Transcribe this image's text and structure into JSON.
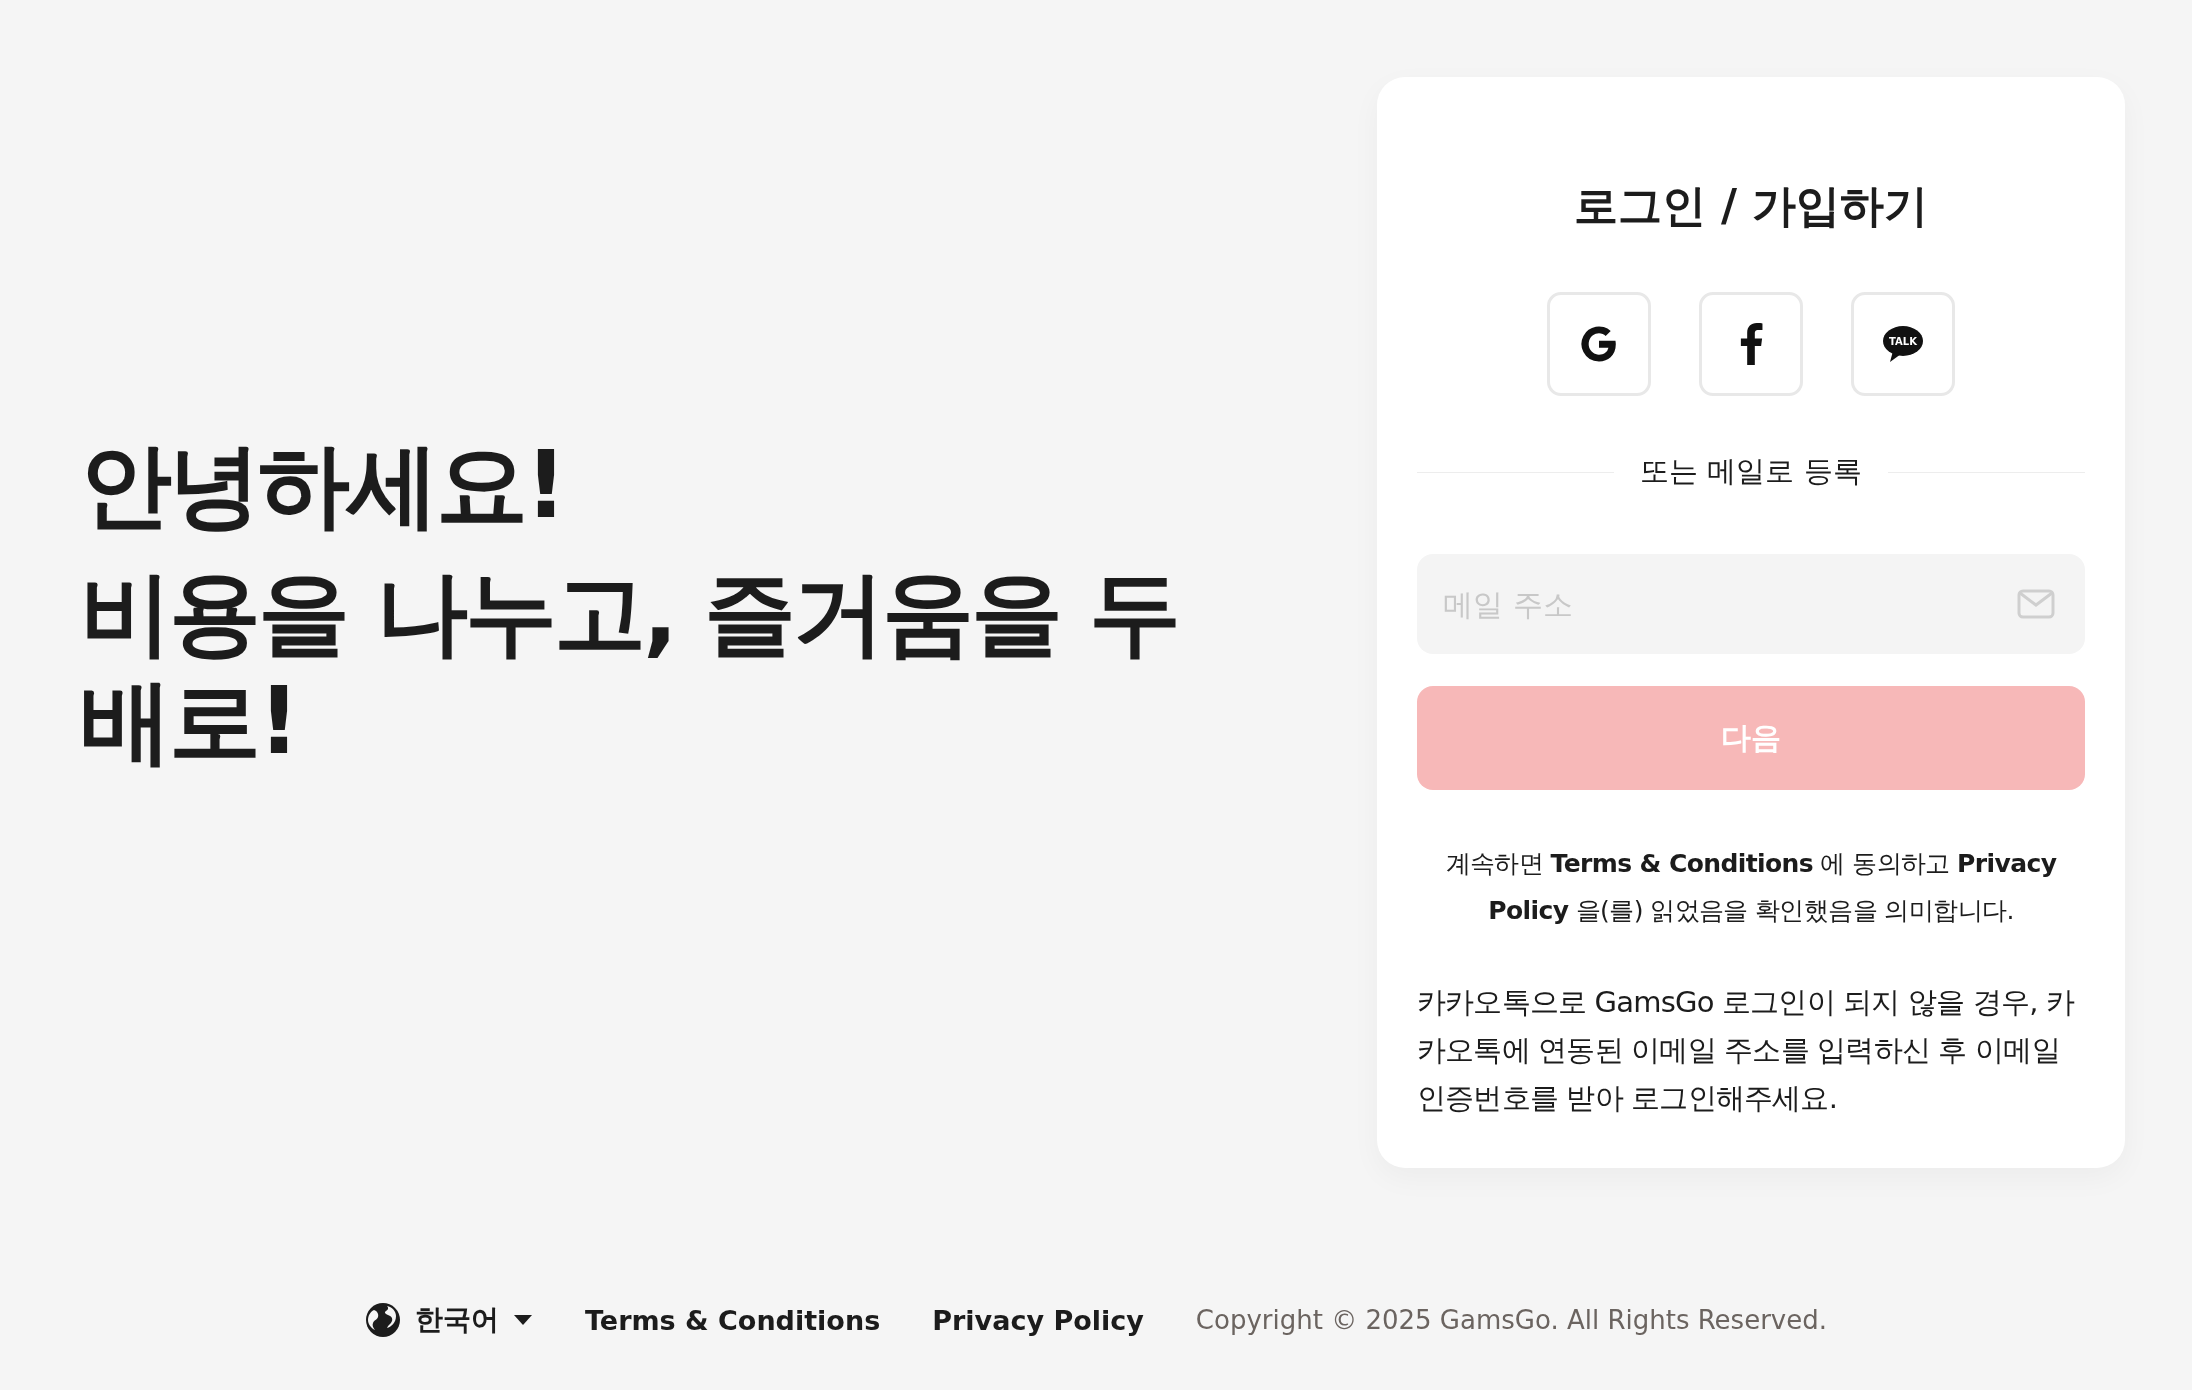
{
  "hero": {
    "lines": [
      "안녕하세요!",
      "비용을 나누고, 즐거움을 두 배로!"
    ]
  },
  "login_card": {
    "title": "로그인 / 가입하기",
    "social_buttons": [
      {
        "kind": "google"
      },
      {
        "kind": "facebook"
      },
      {
        "kind": "kakao",
        "label": "TALK"
      }
    ],
    "divider_text": "또는 메일로 등록",
    "email_field": {
      "placeholder": "메일 주소"
    },
    "next_button": {
      "label": "다음",
      "disabled": true
    },
    "terms_text": "계속하면 **Terms & Conditions** 에 동의하고 **Privacy Policy** 을(를) 읽었음을 확인했음을 의미합니다.",
    "kakao_notice": "카카오톡으로 GamsGo 로그인이 되지 않을 경우, 카카오톡에 연동된 이메일 주소를 입력하신 후 이메일 인증번호를 받아 로그인해주세요."
  },
  "footer": {
    "language": "한국어",
    "links": [
      "Terms & Conditions",
      "Privacy Policy"
    ],
    "copyright": "Copyright © 2025 GamsGo. All Rights Reserved."
  }
}
